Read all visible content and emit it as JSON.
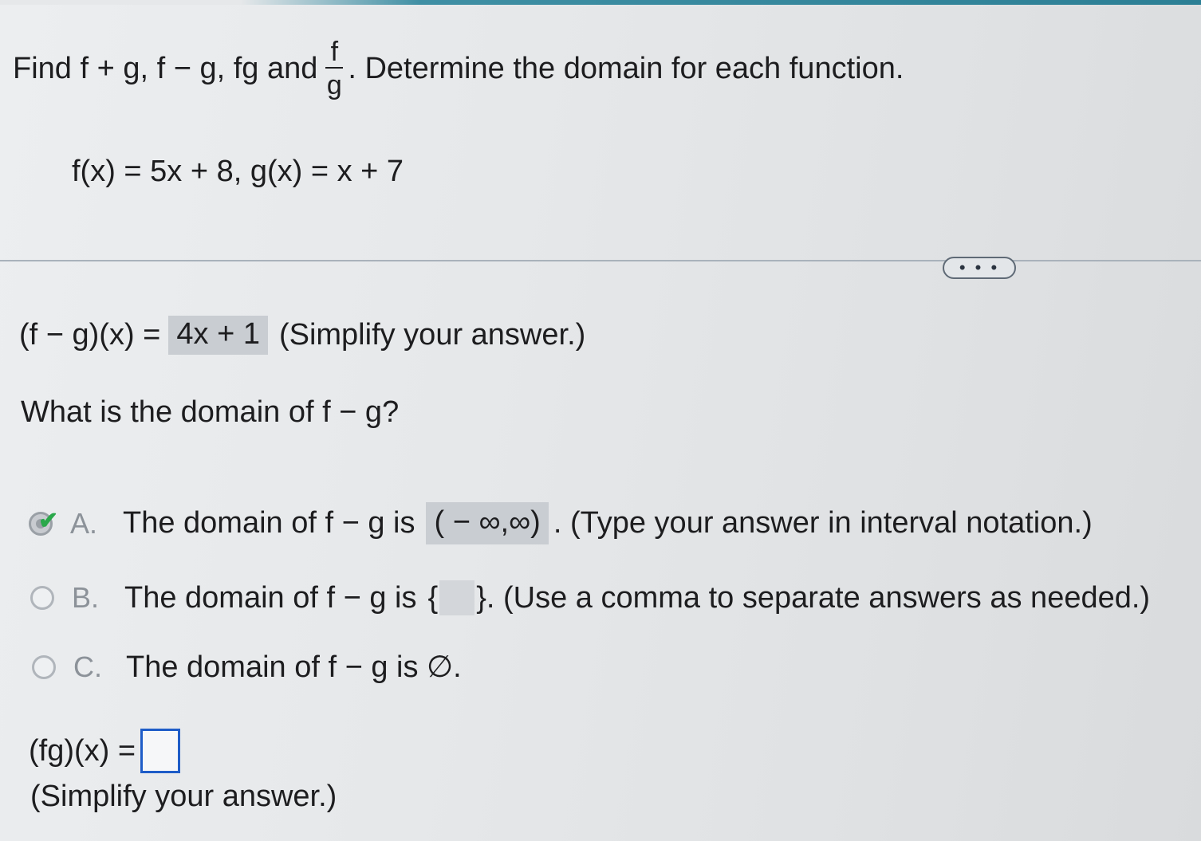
{
  "question": {
    "prefix": "Find f + g, f − g, fg and",
    "fraction_numerator": "f",
    "fraction_denominator": "g",
    "suffix": ". Determine the domain for each function."
  },
  "functions": "f(x) = 5x + 8, g(x) = x + 7",
  "more_button": "• • •",
  "difference": {
    "label": "(f − g)(x) =",
    "answer": "4x + 1",
    "hint": "(Simplify your answer.)"
  },
  "domain_question": "What is the domain of f − g?",
  "options": [
    {
      "letter": "A.",
      "text_before": "The domain of f − g is",
      "answer": "( − ∞,∞)",
      "text_after": ". (Type your answer in interval notation.)",
      "selected": true
    },
    {
      "letter": "B.",
      "text_before": "The domain of f − g is",
      "brace_open": "{",
      "brace_close": "}",
      "text_after": ". (Use a comma to separate answers as needed.)",
      "selected": false
    },
    {
      "letter": "C.",
      "text": "The domain of f − g is ∅.",
      "selected": false
    }
  ],
  "product": {
    "label": "(fg)(x) =",
    "value": "",
    "hint": "(Simplify your answer.)"
  },
  "colors": {
    "accent_bar": "#2c7f95",
    "checkmark": "#2aa84a",
    "input_border": "#1e5cc8",
    "answer_box_bg": "#c9cdd2"
  }
}
